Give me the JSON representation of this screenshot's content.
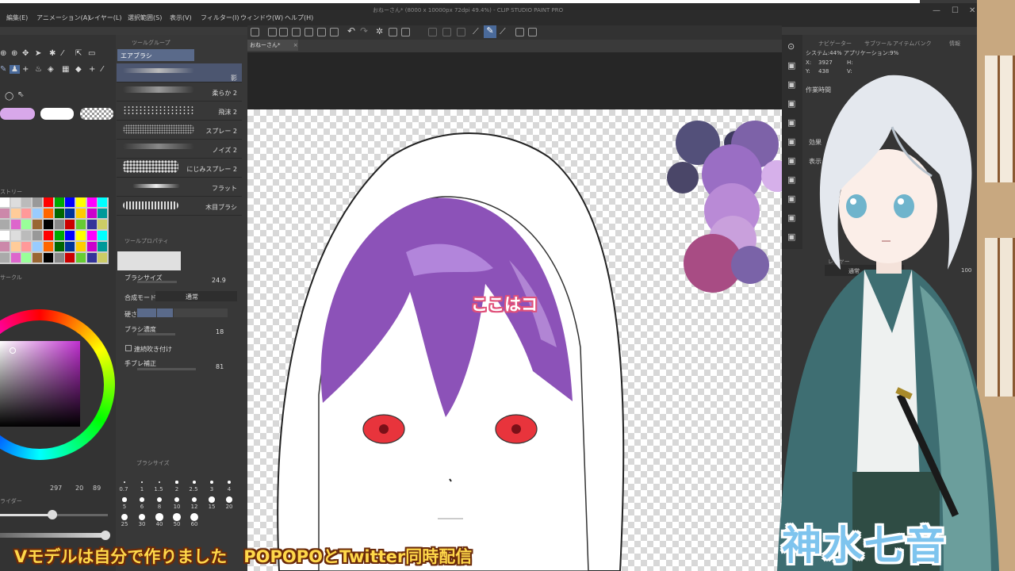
{
  "window": {
    "title": "おねーさん* (8000 x 10000px 72dpi 49.4%) - CLIP STUDIO PAINT PRO",
    "minimize": "—",
    "maximize": "☐",
    "close": "✕"
  },
  "menu": [
    "編集(E)",
    "アニメーション(A)",
    "レイヤー(L)",
    "選択範囲(S)",
    "表示(V)",
    "フィルター(I)",
    "ウィンドウ(W)",
    "ヘルプ(H)"
  ],
  "canvas_tab": "おねーさん*",
  "tool_group_header": "ツールグループ",
  "tool_group_active": "エアブラシ",
  "brushes": [
    "影",
    "柔らか 2",
    "飛沫 2",
    "スプレー 2",
    "ノイズ 2",
    "にじみスプレー 2",
    "フラット",
    "木目ブラシ"
  ],
  "tool_property_header": "ツールプロパティ",
  "properties": {
    "brush_size_label": "ブラシサイズ",
    "brush_size_value": "24.9",
    "blend_mode_label": "合成モード",
    "blend_mode_value": "通常",
    "hardness_label": "硬さ",
    "density_label": "ブラシ濃度",
    "density_value": "18",
    "continuous_label": "連続吹き付け",
    "stabilization_label": "手ブレ補正",
    "stabilization_value": "81"
  },
  "history_label": "ストリー",
  "color_wheel_label": "サークル",
  "color_readout": {
    "h": "297",
    "s": "20",
    "v": "89"
  },
  "slider_label": "ライダー",
  "brush_size_palette_header": "ブラシサイズ",
  "brush_sizes": [
    "0.7",
    "1",
    "1.5",
    "2",
    "2.5",
    "3",
    "4",
    "5",
    "6",
    "8",
    "10",
    "12",
    "15",
    "20",
    "25",
    "30",
    "40",
    "50",
    "60"
  ],
  "right_panel": {
    "tabs": [
      "ナビゲーター",
      "サブツール",
      "アイテムバンク",
      "情報"
    ],
    "system": "システム:44% アプリケーション:9%",
    "x_label": "X:",
    "x_value": "3927",
    "y_label": "Y:",
    "y_value": "438",
    "h_label": "H:",
    "v_label": "V:",
    "work_time": "作業時間",
    "effect": "効果",
    "display": "表示",
    "layer_tab": "レイヤー",
    "layer_mode": "通常",
    "layer_opacity": "100"
  },
  "annotation": "ここはコ",
  "subtitle": "Vモデルは自分で作りました　POPOPOとTwitter同時配信",
  "nameplate": "神水七音",
  "colors": {
    "hair": "#8c52b8",
    "hair_highlight": "#b88ee0",
    "eye": "#e8343c",
    "swatch_dark": "#53507a",
    "swatch_purple": "#9a6ec4",
    "swatch_lilac": "#c9a0dc",
    "swatch_magenta": "#a84c84",
    "accent_blue": "#7ec4ee",
    "subtitle": "#ffd84a"
  },
  "icons": [
    "pen-icon",
    "move-icon",
    "lasso-icon",
    "eraser-icon",
    "fill-icon",
    "undo-icon",
    "redo-icon"
  ]
}
